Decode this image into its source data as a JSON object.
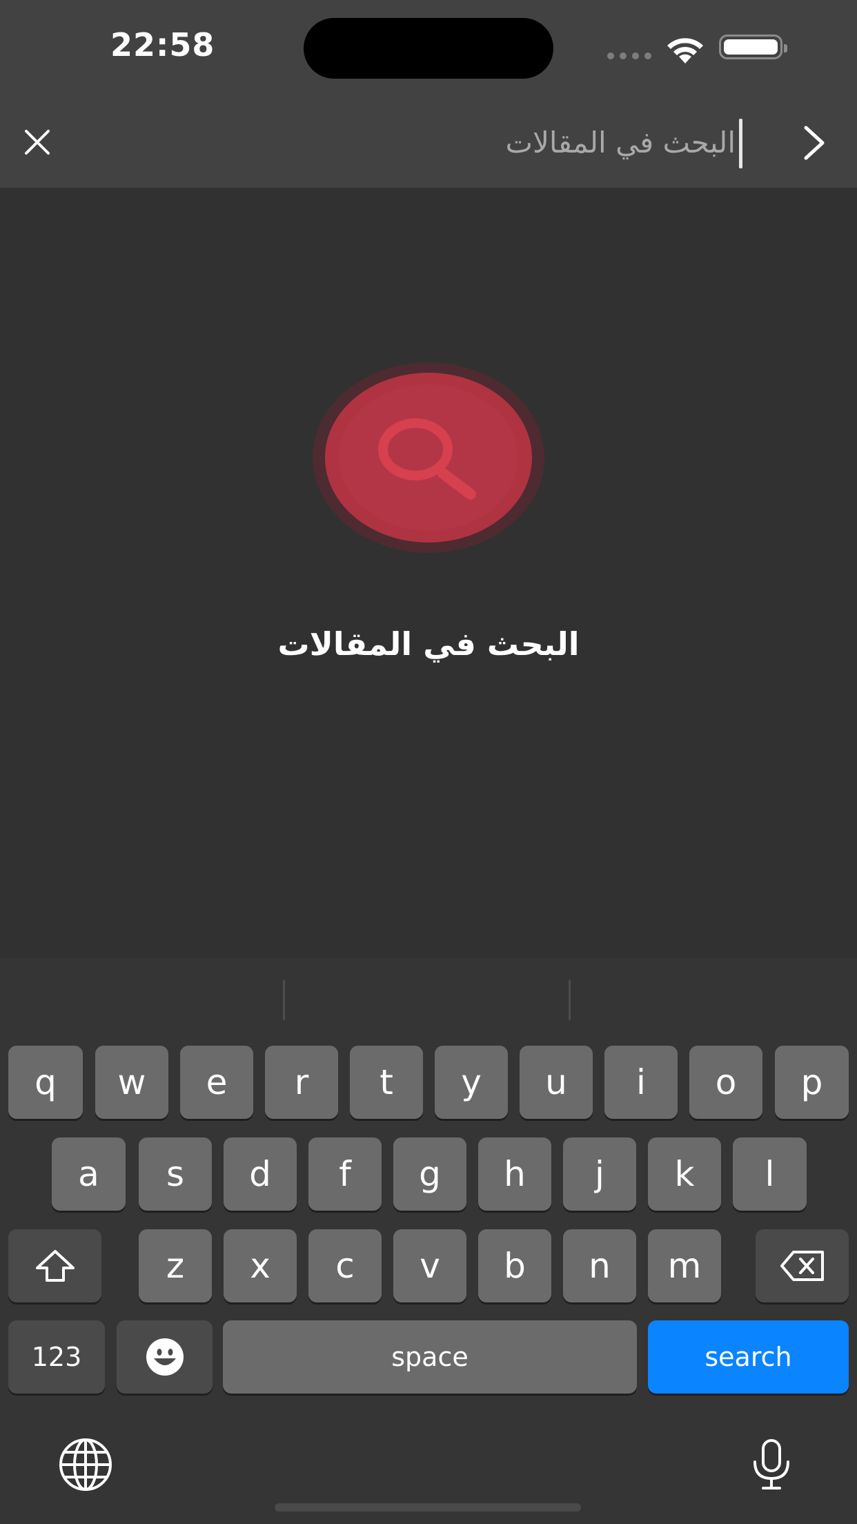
{
  "status_bar": {
    "time": "22:58"
  },
  "nav": {
    "close_icon": "close-icon",
    "back_icon": "chevron-right-icon",
    "search_placeholder": "البحث في المقالات"
  },
  "empty_state": {
    "icon": "search-icon",
    "title": "البحث في المقالات",
    "accent_color": "#b03342"
  },
  "keyboard": {
    "row1": [
      "q",
      "w",
      "e",
      "r",
      "t",
      "y",
      "u",
      "i",
      "o",
      "p"
    ],
    "row2": [
      "a",
      "s",
      "d",
      "f",
      "g",
      "h",
      "j",
      "k",
      "l"
    ],
    "row3": [
      "z",
      "x",
      "c",
      "v",
      "b",
      "n",
      "m"
    ],
    "numbers_label": "123",
    "space_label": "space",
    "search_label": "search",
    "search_color": "#0a84ff"
  }
}
